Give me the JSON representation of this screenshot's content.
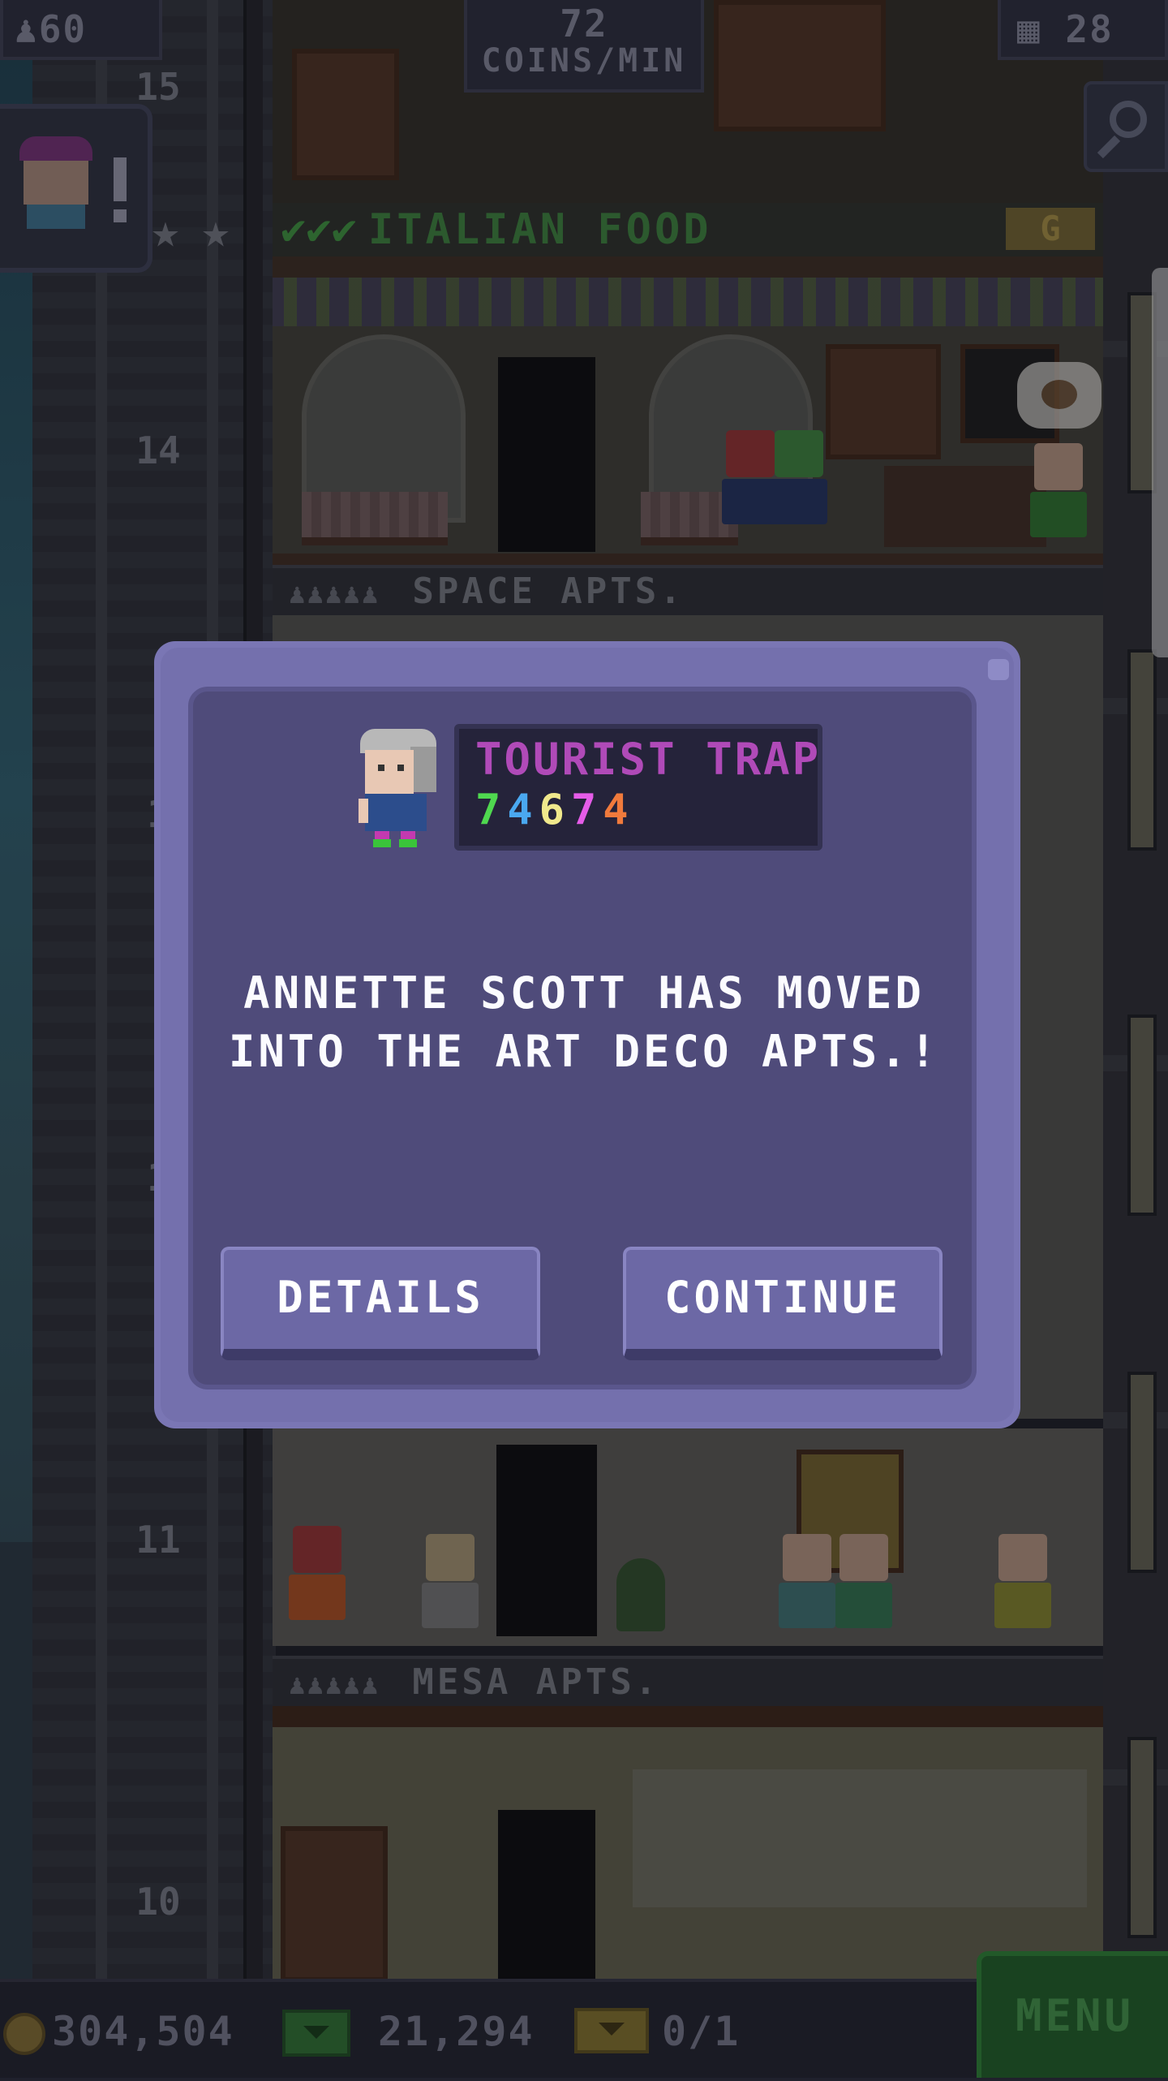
{
  "hud": {
    "population": "60",
    "coins_per_min_value": "72",
    "coins_per_min_label": "COINS/MIN",
    "floors": "28"
  },
  "floors": {
    "f15": "15",
    "f14": "14",
    "f13": "1",
    "f12": "1",
    "f11": "11",
    "f10": "10",
    "italian_food": "ITALIAN FOOD",
    "italian_checks": "✔✔✔",
    "g_badge": "G",
    "space_apts": "SPACE APTS.",
    "mesa_apts": "MESA APTS.",
    "people_icons": "♟♟♟♟♟"
  },
  "notification": {
    "alert": "!"
  },
  "dialog": {
    "trait_title": "TOURIST TRAP",
    "trait_digits": [
      {
        "value": "7",
        "color": "#4fd84f"
      },
      {
        "value": "4",
        "color": "#4aa8f0"
      },
      {
        "value": "6",
        "color": "#f0e88c"
      },
      {
        "value": "7",
        "color": "#e55ce8"
      },
      {
        "value": "4",
        "color": "#f07a3c"
      }
    ],
    "message_line1": "ANNETTE SCOTT HAS MOVED",
    "message_line2": "INTO THE ART DECO APTS.!",
    "details_label": "DETAILS",
    "continue_label": "CONTINUE"
  },
  "bottom": {
    "coins": "304,504",
    "bux": "21,294",
    "tickets": "0/1",
    "menu_label": "MENU"
  },
  "colors": {
    "dialog_outer": "#7470ad",
    "dialog_inner": "#4f4b7a",
    "button": "#6c68a5",
    "trait_title": "#b04ab8",
    "menu_green": "#1f5a26"
  }
}
